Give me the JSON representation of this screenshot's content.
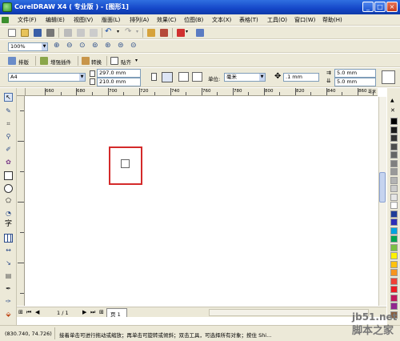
{
  "window": {
    "title": "CorelDRAW X4 ( 专业版 ) - [图形1]",
    "minimize": "_",
    "maximize": "□",
    "close": "×"
  },
  "menu": [
    "文件(F)",
    "编辑(E)",
    "视图(V)",
    "版面(L)",
    "排列(A)",
    "效果(C)",
    "位图(B)",
    "文本(X)",
    "表格(T)",
    "工具(O)",
    "窗口(W)",
    "帮助(H)"
  ],
  "toolbar": {
    "zoom": "100%"
  },
  "plugins": {
    "layout": "排版",
    "enhance": "增强插件",
    "convert": "转换",
    "align": "贴齐"
  },
  "property_bar": {
    "page_size": "A4",
    "width": "297.0 mm",
    "height": "210.0 mm",
    "unit_label": "单位:",
    "unit": "毫米",
    "nudge": ".1 mm",
    "dup_x": "5.0 mm",
    "dup_y": "5.0 mm"
  },
  "ruler": {
    "labels": [
      "660",
      "680",
      "700",
      "720",
      "740",
      "760",
      "780",
      "800",
      "820",
      "840",
      "860"
    ],
    "unit": "毫米"
  },
  "page_nav": {
    "current": "1 / 1",
    "tab": "页 1"
  },
  "status": {
    "coords": "(830.740, 74.726)",
    "hint": "接着单击可进行拖动或缩放；再单击可旋转或倾斜；双击工具，可选择所有对象；按住 Shi..."
  },
  "watermark": {
    "site": "jb51.net",
    "brand": "脚本之家"
  },
  "palette": [
    "#000000",
    "#1a1a1a",
    "#333333",
    "#4d4d4d",
    "#666666",
    "#808080",
    "#999999",
    "#b3b3b3",
    "#cccccc",
    "#e6e6e6",
    "#ffffff",
    "#1f3d99",
    "#2e2eb8",
    "#00a3e0",
    "#00a651",
    "#7bc043",
    "#fff200",
    "#ffc20e",
    "#f7941d",
    "#ef4136",
    "#ed1c24",
    "#c2185b",
    "#92278f",
    "#8b5e3c"
  ]
}
